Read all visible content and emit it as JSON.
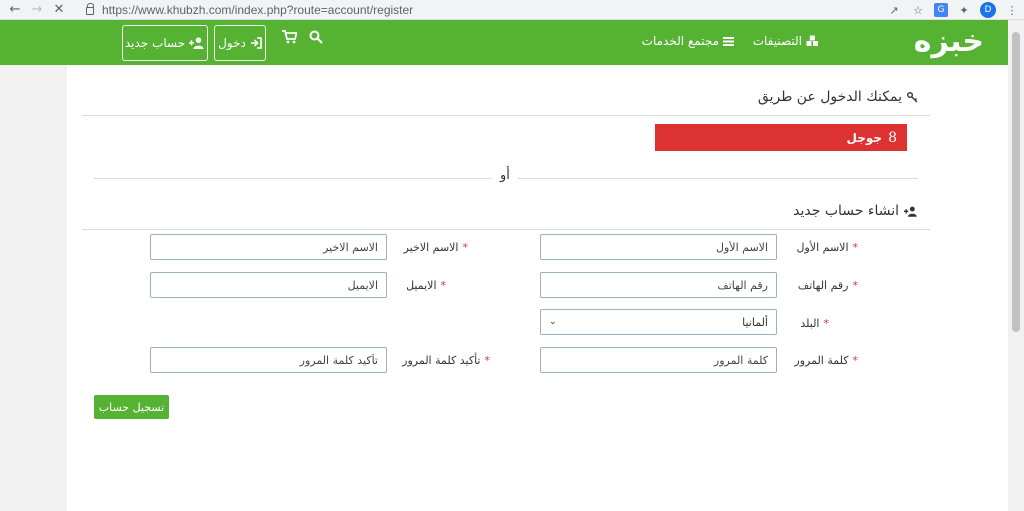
{
  "browser": {
    "url": "https://www.khubzh.com/index.php?route=account/register",
    "profile_initial": "D"
  },
  "header": {
    "logo": "خبزه",
    "nav": {
      "categories": "التصنيفات",
      "services": "مجتمع الخدمات"
    },
    "login_label": "دخول",
    "register_label": "حساب جديد"
  },
  "social": {
    "title": "يمكنك الدخول عن طريق",
    "google_label": "جوجل",
    "google_glyph": "8",
    "or_text": "أو"
  },
  "form": {
    "title": "انشاء حساب جديد",
    "first_name": {
      "label": "الاسم الأول",
      "placeholder": "الاسم الأول"
    },
    "last_name": {
      "label": "الاسم الاخير",
      "placeholder": "الاسم الاخير"
    },
    "phone": {
      "label": "رقم الهاتف",
      "placeholder": "رقم الهاتف"
    },
    "email": {
      "label": "الايميل",
      "placeholder": "الايميل"
    },
    "country": {
      "label": "البلد",
      "value": "ألمانيا"
    },
    "password": {
      "label": "كلمة المرور",
      "placeholder": "كلمة المرور"
    },
    "confirm": {
      "label": "تأكيد كلمة المرور",
      "placeholder": "تأكيد كلمة المرور"
    },
    "required_mark": "*",
    "submit_label": "تسجيل حساب"
  },
  "colors": {
    "brand_green": "#55b233",
    "google_red": "#dc3232"
  }
}
